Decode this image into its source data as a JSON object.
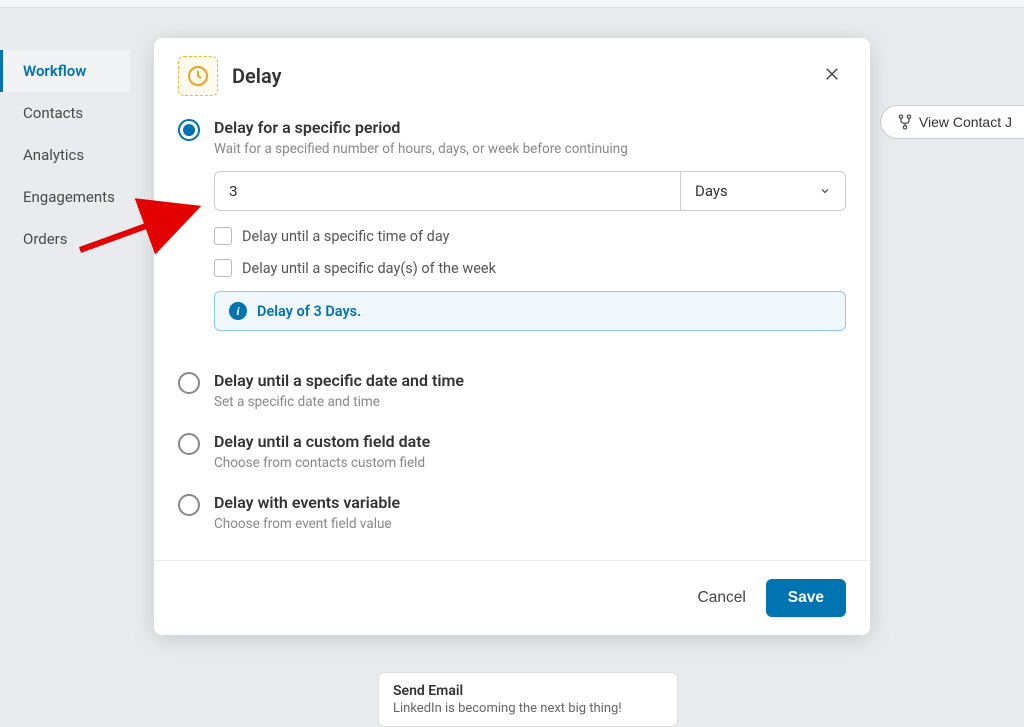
{
  "sidebar": {
    "items": [
      {
        "label": "Workflow",
        "active": true
      },
      {
        "label": "Contacts",
        "active": false
      },
      {
        "label": "Analytics",
        "active": false
      },
      {
        "label": "Engagements",
        "active": false
      },
      {
        "label": "Orders",
        "active": false
      }
    ]
  },
  "top_button": {
    "label": "View Contact J"
  },
  "modal": {
    "title": "Delay",
    "options": [
      {
        "title": "Delay for a specific period",
        "desc": "Wait for a specified number of hours, days, or week before continuing",
        "selected": true
      },
      {
        "title": "Delay until a specific date and time",
        "desc": "Set a specific date and time",
        "selected": false
      },
      {
        "title": "Delay until a custom field date",
        "desc": "Choose from contacts custom field",
        "selected": false
      },
      {
        "title": "Delay with events variable",
        "desc": "Choose from event field value",
        "selected": false
      }
    ],
    "delay_value": "3",
    "delay_unit": "Days",
    "checkboxes": [
      {
        "label": "Delay until a specific time of day",
        "checked": false
      },
      {
        "label": "Delay until a specific day(s) of the week",
        "checked": false
      }
    ],
    "info_text": "Delay of 3 Days.",
    "cancel_label": "Cancel",
    "save_label": "Save"
  },
  "bg_card": {
    "title": "Send Email",
    "subtitle": "LinkedIn is becoming the next big thing!"
  }
}
